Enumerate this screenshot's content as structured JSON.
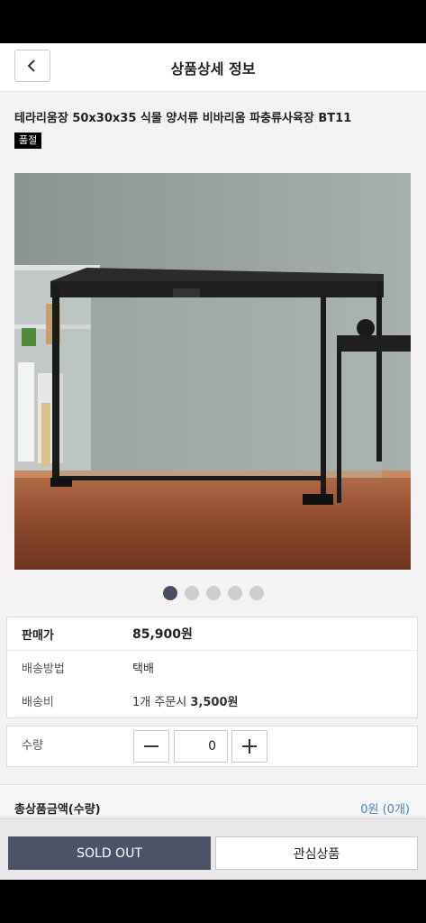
{
  "header": {
    "title": "상품상세 정보"
  },
  "product": {
    "name": "테라리움장 50x30x35 식물 양서류 비바리움 파충류사육장 BT11",
    "badge": "품절"
  },
  "carousel": {
    "count": 5,
    "active_index": 0
  },
  "info": {
    "price_label": "판매가",
    "price_value": "85,900원",
    "shipping_method_label": "배송방법",
    "shipping_method_value": "택배",
    "shipping_fee_label": "배송비",
    "shipping_fee_prefix": "1개 주문시",
    "shipping_fee_value": "3,500원"
  },
  "quantity": {
    "label": "수량",
    "value": "0"
  },
  "total": {
    "label": "총상품금액(수량)",
    "value": "0원 (0개)"
  },
  "actions": {
    "soldout_label": "SOLD OUT",
    "wishlist_label": "관심상품"
  },
  "colors": {
    "accent": "#4a7fd0",
    "soldout_bg": "#4d5366",
    "dot_active": "#4a4f60"
  },
  "icons": {
    "back": "chevron-left-icon",
    "minus": "minus-icon",
    "plus": "plus-icon"
  }
}
